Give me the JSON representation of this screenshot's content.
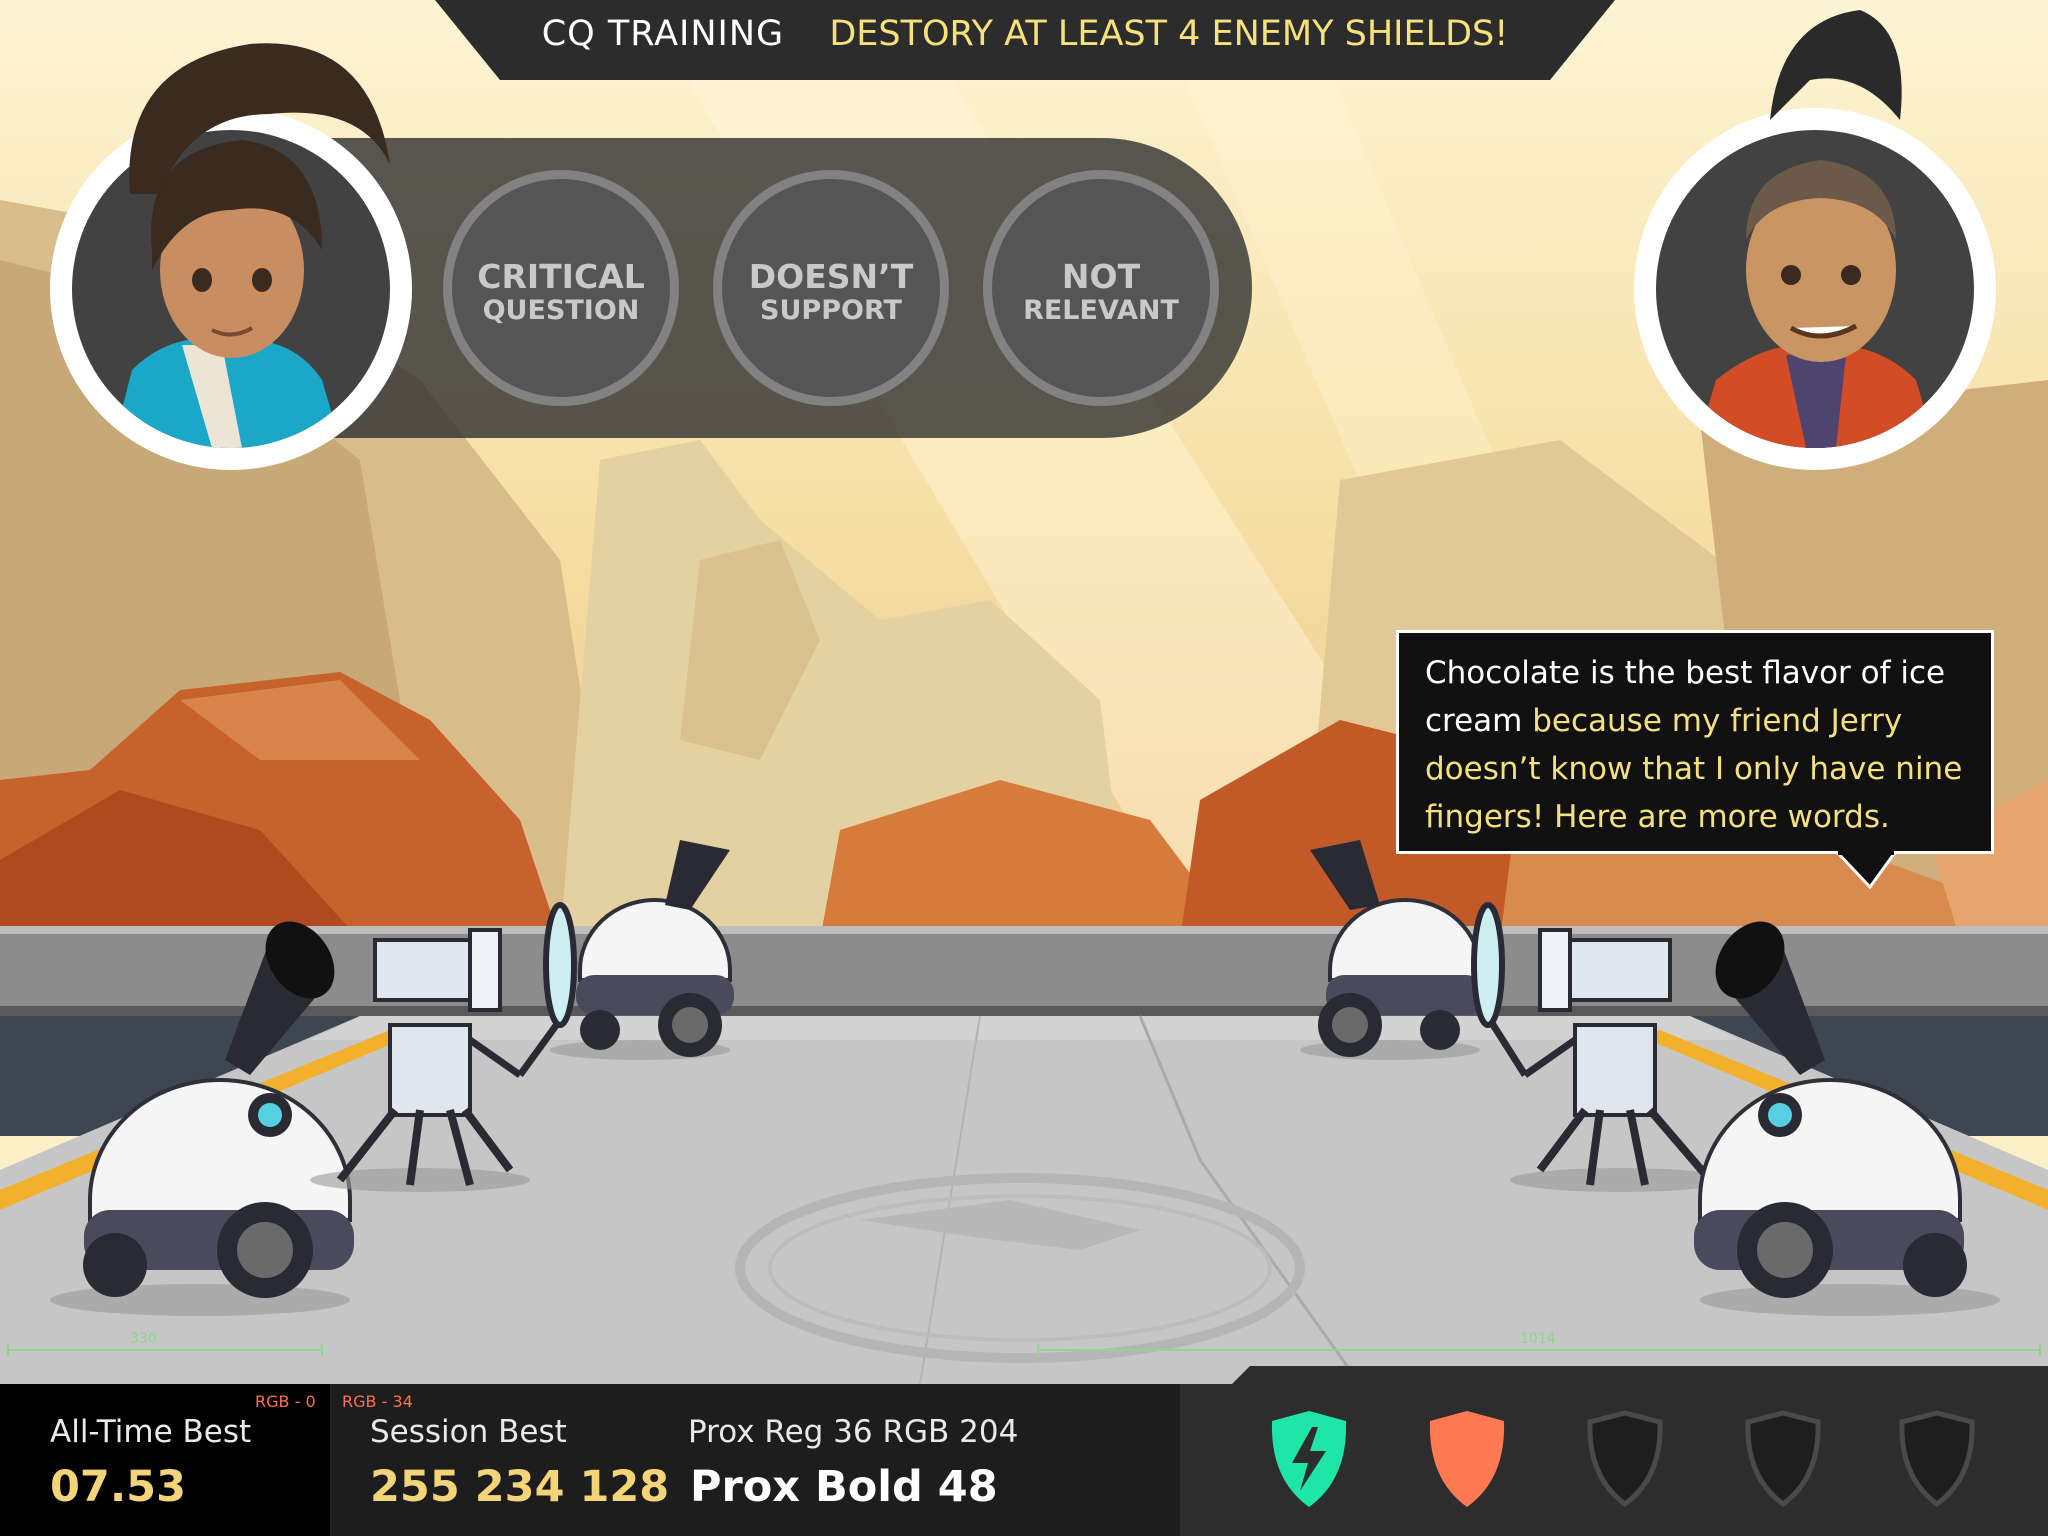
{
  "header": {
    "title": "CQ TRAINING",
    "objective": "DESTORY AT LEAST 4 ENEMY SHIELDS!"
  },
  "answers": [
    {
      "line1": "CRITICAL",
      "line2": "QUESTION"
    },
    {
      "line1": "DOESN’T",
      "line2": "SUPPORT"
    },
    {
      "line1": "NOT",
      "line2": "RELEVANT"
    }
  ],
  "speech": {
    "lead": "Chocolate is the best flavor of ice cream",
    "highlight": " because my friend Jerry doesn’t know that I only have nine fingers! Here are more words."
  },
  "measurements": {
    "left": "330",
    "right": "1014"
  },
  "hud": {
    "all_time_label": "All-Time Best",
    "all_time_value": "07.53",
    "all_time_rgb": "RGB - 0",
    "session_label": "Session Best",
    "session_value": "255 234 128",
    "session_rgb": "RGB - 34",
    "prox_label": "Prox Reg 36 RGB 204",
    "prox_value": "Prox Bold 48"
  },
  "shields": [
    {
      "state": "broken",
      "color": "#1ee6a8",
      "icon": "broken-shield-icon"
    },
    {
      "state": "active",
      "color": "#ff7a52",
      "icon": "shield-icon"
    },
    {
      "state": "empty",
      "color": "#1e1e1e",
      "icon": "shield-outline-icon"
    },
    {
      "state": "empty",
      "color": "#1e1e1e",
      "icon": "shield-outline-icon"
    },
    {
      "state": "empty",
      "color": "#1e1e1e",
      "icon": "shield-outline-icon"
    }
  ],
  "colors": {
    "accent_yellow": "#f6e27c",
    "enemy_orange": "#ff7a52",
    "player_teal": "#1ee6a8"
  }
}
